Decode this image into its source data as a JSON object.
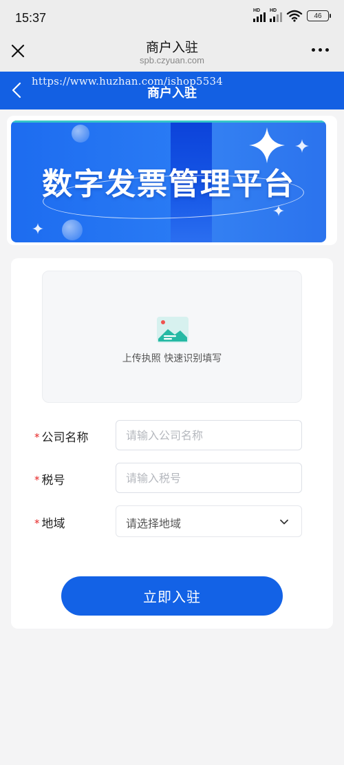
{
  "status_bar": {
    "time": "15:37",
    "signal1_label": "HD",
    "signal2_label": "HD",
    "wifi_icon": "wifi-icon",
    "battery": "46"
  },
  "title_bar": {
    "title": "商户入驻",
    "url": "spb.czyuan.com",
    "close_icon": "close-icon",
    "more_icon": "more-icon"
  },
  "nav": {
    "title": "商户入驻",
    "watermark": "https://www.huzhan.com/ishop5534",
    "back_icon": "chevron-left-icon",
    "bg_color": "#1360e3"
  },
  "banner": {
    "title": "数字发票管理平台"
  },
  "upload": {
    "icon": "image-icon",
    "text": "上传执照 快速识别填写"
  },
  "form": {
    "required_mark": "*",
    "company": {
      "label": "公司名称",
      "placeholder": "请输入公司名称",
      "value": ""
    },
    "tax": {
      "label": "税号",
      "placeholder": "请输入税号",
      "value": ""
    },
    "region": {
      "label": "地域",
      "placeholder": "请选择地域",
      "icon": "chevron-down-icon"
    }
  },
  "submit": {
    "label": "立即入驻",
    "color": "#1362e6"
  }
}
